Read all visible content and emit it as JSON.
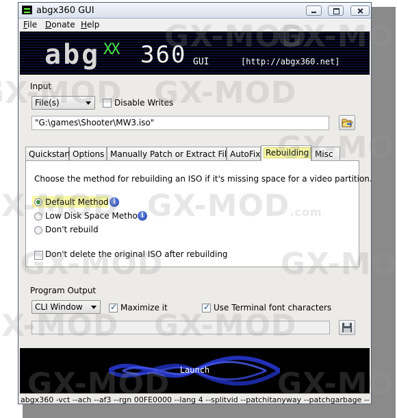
{
  "window": {
    "title": "abgx360 GUI"
  },
  "menu": {
    "items": [
      "File",
      "Donate",
      "Help"
    ]
  },
  "banner": {
    "logo_letters": "abg",
    "logo_x": "XX",
    "logo_number": "360",
    "logo_gui": "GUI",
    "url": "[http://abgx360.net]"
  },
  "input": {
    "group_label": "Input",
    "source_select": "File(s)",
    "disable_writes_label": "Disable Writes",
    "disable_writes_checked": false,
    "path_value": "\"G:\\games\\Shooter\\MW3.iso\""
  },
  "tabs": {
    "items": [
      "Quickstart",
      "Options",
      "Manually Patch or Extract Files",
      "AutoFix",
      "Rebuilding",
      "Misc"
    ],
    "active": "Rebuilding"
  },
  "rebuilding": {
    "description": "Choose the method for rebuilding an ISO if it's missing space for a video partition.",
    "options": [
      {
        "label": "Default Method",
        "checked": true,
        "info": true
      },
      {
        "label": "Low Disk Space Method",
        "checked": false,
        "info": true
      },
      {
        "label": "Don't rebuild",
        "checked": false,
        "info": false
      }
    ],
    "dont_delete_label": "Don't delete the original ISO after rebuilding",
    "dont_delete_checked": false
  },
  "program_output": {
    "group_label": "Program Output",
    "output_select": "CLI Window",
    "maximize_label": "Maximize it",
    "maximize_checked": true,
    "terminal_font_label": "Use Terminal font characters",
    "terminal_font_checked": true
  },
  "launch": {
    "label": "Launch"
  },
  "status": {
    "command": "abgx360 -vct --ach --af3 --rgn 00FE0000 --lang 4 --splitvid --patchitanyway --patchgarbage --"
  },
  "watermark": {
    "text": "GX-MOD",
    "suffix": ".com"
  },
  "colors": {
    "highlight": "#f8f7a6",
    "banner_bg": "#000000",
    "logo_green": "#46e84a"
  },
  "icons": [
    "app-icon",
    "minimize-icon",
    "maximize-icon",
    "close-icon",
    "folder-open-icon",
    "info-icon",
    "save-icon"
  ]
}
